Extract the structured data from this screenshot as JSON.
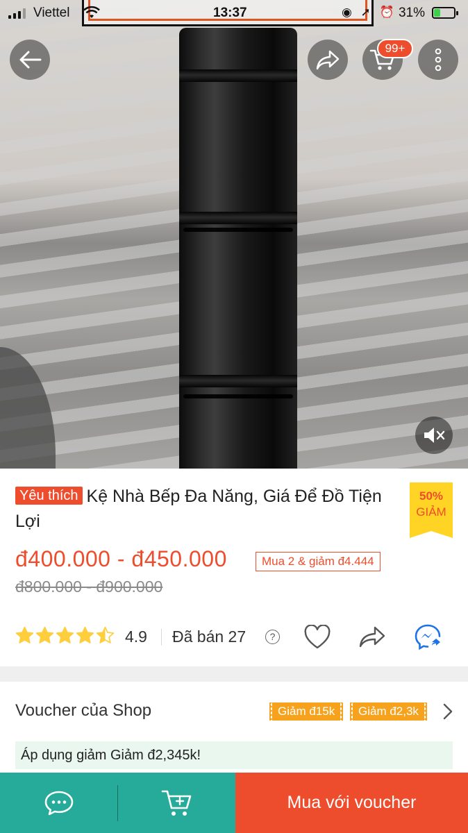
{
  "status_bar": {
    "carrier": "Viettel",
    "time": "13:37",
    "battery": "31%"
  },
  "header": {
    "cart_badge": "99+"
  },
  "product": {
    "tag": "Yêu thích",
    "title": "Kệ Nhà Bếp Đa Năng, Giá Để Đồ Tiện Lợi",
    "discount_pct": "50%",
    "discount_label": "GIẢM",
    "price_range": "đ400.000 - đ450.000",
    "bundle_offer": "Mua 2 & giảm đ4.444",
    "original_price_range": "đ800.000 - đ900.000",
    "rating": "4.9",
    "rating_stars": 4.5,
    "sold": "Đã bán 27"
  },
  "voucher": {
    "title": "Voucher của Shop",
    "chips": [
      "Giảm đ15k",
      "Giảm đ2,3k"
    ],
    "apply_message": "Áp dụng giảm Giảm đ2,345k!"
  },
  "bottom_bar": {
    "buy_label": "Mua với voucher"
  },
  "colors": {
    "accent": "#ee4d2d",
    "teal": "#26aa99",
    "star": "#ffce3d",
    "voucher_chip": "#f7a21d"
  }
}
